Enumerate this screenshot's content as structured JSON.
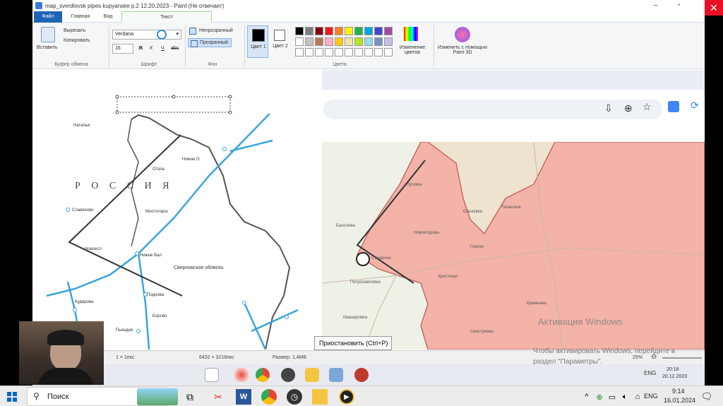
{
  "window": {
    "title": "map_sverdlovsk pipes kupyanske p.2 12.20.2023 - Paint (Не отвечает)"
  },
  "ribbon": {
    "tabs": [
      {
        "label": "Файл"
      },
      {
        "label": "Главная"
      },
      {
        "label": "Вид"
      },
      {
        "label": "Текст"
      }
    ],
    "clipboard": {
      "paste": "Вставить",
      "cut": "Вырезать",
      "copy": "Копировать",
      "group": "Буфер обмена"
    },
    "font": {
      "family": "Verdana",
      "size": "16",
      "group": "Шрифт",
      "styles": [
        "Ж",
        "К",
        "Ч",
        "abc"
      ]
    },
    "background": {
      "opaque": "Непрозрачный",
      "transparent": "Прозрачный",
      "group": "Фон"
    },
    "colors": {
      "color1": "Цвет 1",
      "color2": "Цвет 2",
      "edit": "Изменение цветов",
      "group": "Цвета",
      "palette_row1": [
        "#000000",
        "#7f7f7f",
        "#880015",
        "#ed1c24",
        "#ff7f27",
        "#fff200",
        "#22b14c",
        "#00a2e8",
        "#3f48cc",
        "#a349a4"
      ],
      "palette_row2": [
        "#ffffff",
        "#c3c3c3",
        "#b97a57",
        "#ffaec9",
        "#ffc90e",
        "#efe4b0",
        "#b5e61d",
        "#99d9ea",
        "#7092be",
        "#c8bfe7"
      ]
    },
    "paint3d": "Изменить с помощью Paint 3D"
  },
  "left_map": {
    "country": "Р О С С И Я",
    "region": "Сверловское облвсеь",
    "labels": [
      "Наталья",
      "Оталь",
      "Нижне О",
      "Мостогорск",
      "Славяново",
      "Новоесл",
      "Кудирова",
      "Поднова",
      "Борово",
      "Пьяндия",
      "Нижне Вал"
    ]
  },
  "browser": {
    "toolbar_icons": [
      "install-icon",
      "zoom-icon",
      "bookmark-star-icon",
      "translate-icon",
      "refresh-icon"
    ]
  },
  "right_map": {
    "labels": [
      "Луговка",
      "Новоегорова",
      "Смадичок",
      "Петропавловка",
      "Квашировка",
      "Ольховка",
      "Таганское",
      "Гнатия",
      "Хрестище",
      "Кременна",
      "Свистунова",
      "Бахолева"
    ]
  },
  "statusbar": {
    "selection": "1 × 1пкс",
    "dimensions": "6432 × 3216пкс",
    "size": "Размер: 1,4МБ",
    "zoom": "25%"
  },
  "tooltip": "Приостановить (Ctrl+P)",
  "watermark": {
    "title": "Активация Windows",
    "line1": "Чтобы активировать Windows, перейдите в",
    "line2": "раздел \"Параметры\"."
  },
  "inner_tray": {
    "lang": "ENG",
    "time": "20:18",
    "date": "20.12.2023"
  },
  "taskbar": {
    "search": "Поиск",
    "lang": "ENG",
    "time": "9:14",
    "date": "16.01.2024"
  }
}
